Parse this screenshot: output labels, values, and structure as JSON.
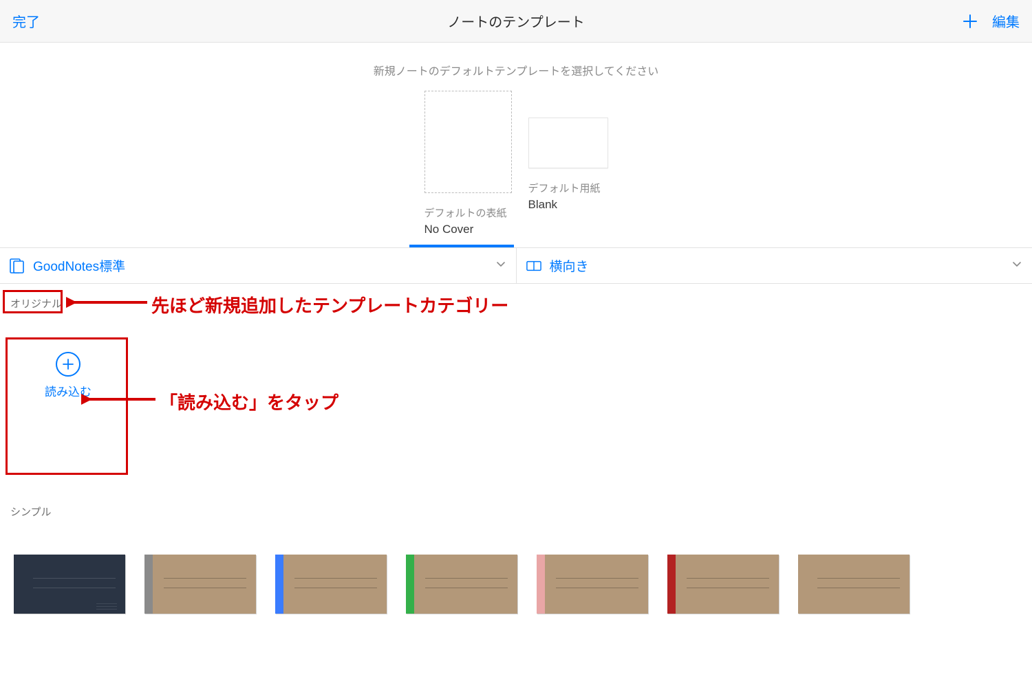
{
  "header": {
    "done": "完了",
    "title": "ノートのテンプレート",
    "edit": "編集"
  },
  "instruction": "新規ノートのデフォルトテンプレートを選択してください",
  "defaults": {
    "cover": {
      "caption": "デフォルトの表紙",
      "name": "No Cover"
    },
    "paper": {
      "caption": "デフォルト用紙",
      "name": "Blank"
    }
  },
  "selectors": {
    "group": "GoodNotes標準",
    "orientation": "横向き"
  },
  "categories": {
    "original": "オリジナル",
    "simple": "シンプル"
  },
  "import_button": "読み込む",
  "covers": [
    {
      "style": "dark"
    },
    {
      "style": "grey"
    },
    {
      "style": "blue"
    },
    {
      "style": "green"
    },
    {
      "style": "pink"
    },
    {
      "style": "red"
    },
    {
      "style": "none"
    }
  ],
  "annotations": {
    "category": "先ほど新規追加したテンプレートカテゴリー",
    "import": "「読み込む」をタップ"
  }
}
